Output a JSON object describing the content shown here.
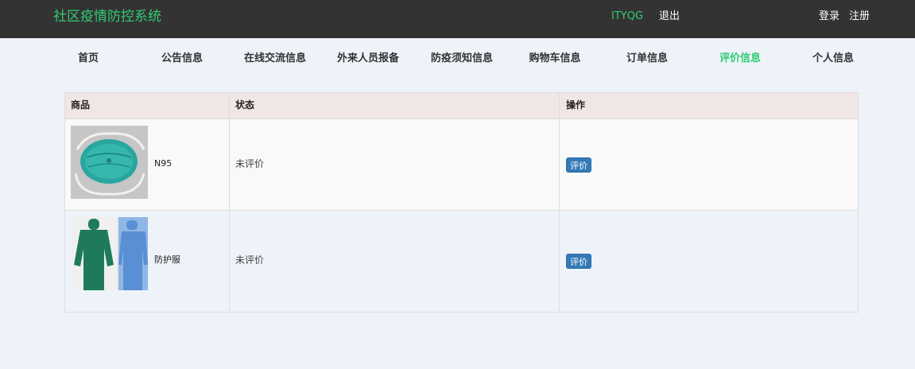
{
  "header": {
    "site_title": "社区疫情防控系统",
    "username": "ITYQG",
    "logout_label": "退出",
    "login_label": "登录",
    "register_label": "注册"
  },
  "nav": {
    "items": [
      {
        "label": "首页"
      },
      {
        "label": "公告信息"
      },
      {
        "label": "在线交流信息"
      },
      {
        "label": "外来人员报备"
      },
      {
        "label": "防疫须知信息"
      },
      {
        "label": "购物车信息"
      },
      {
        "label": "订单信息"
      },
      {
        "label": "评价信息",
        "active": true
      },
      {
        "label": "个人信息"
      }
    ]
  },
  "table": {
    "headers": [
      "商品",
      "状态",
      "操作"
    ],
    "rows": [
      {
        "product": "N95",
        "status": "未评价",
        "action": "评价",
        "image": "n95-mask"
      },
      {
        "product": "防护服",
        "status": "未评价",
        "action": "评价",
        "image": "protective-suit"
      }
    ]
  },
  "colors": {
    "topbar_bg": "#333333",
    "accent_green": "#2ecc71",
    "page_bg": "#eef3fa",
    "header_row_bg": "#f1e6e6",
    "button_blue": "#337ab7"
  }
}
